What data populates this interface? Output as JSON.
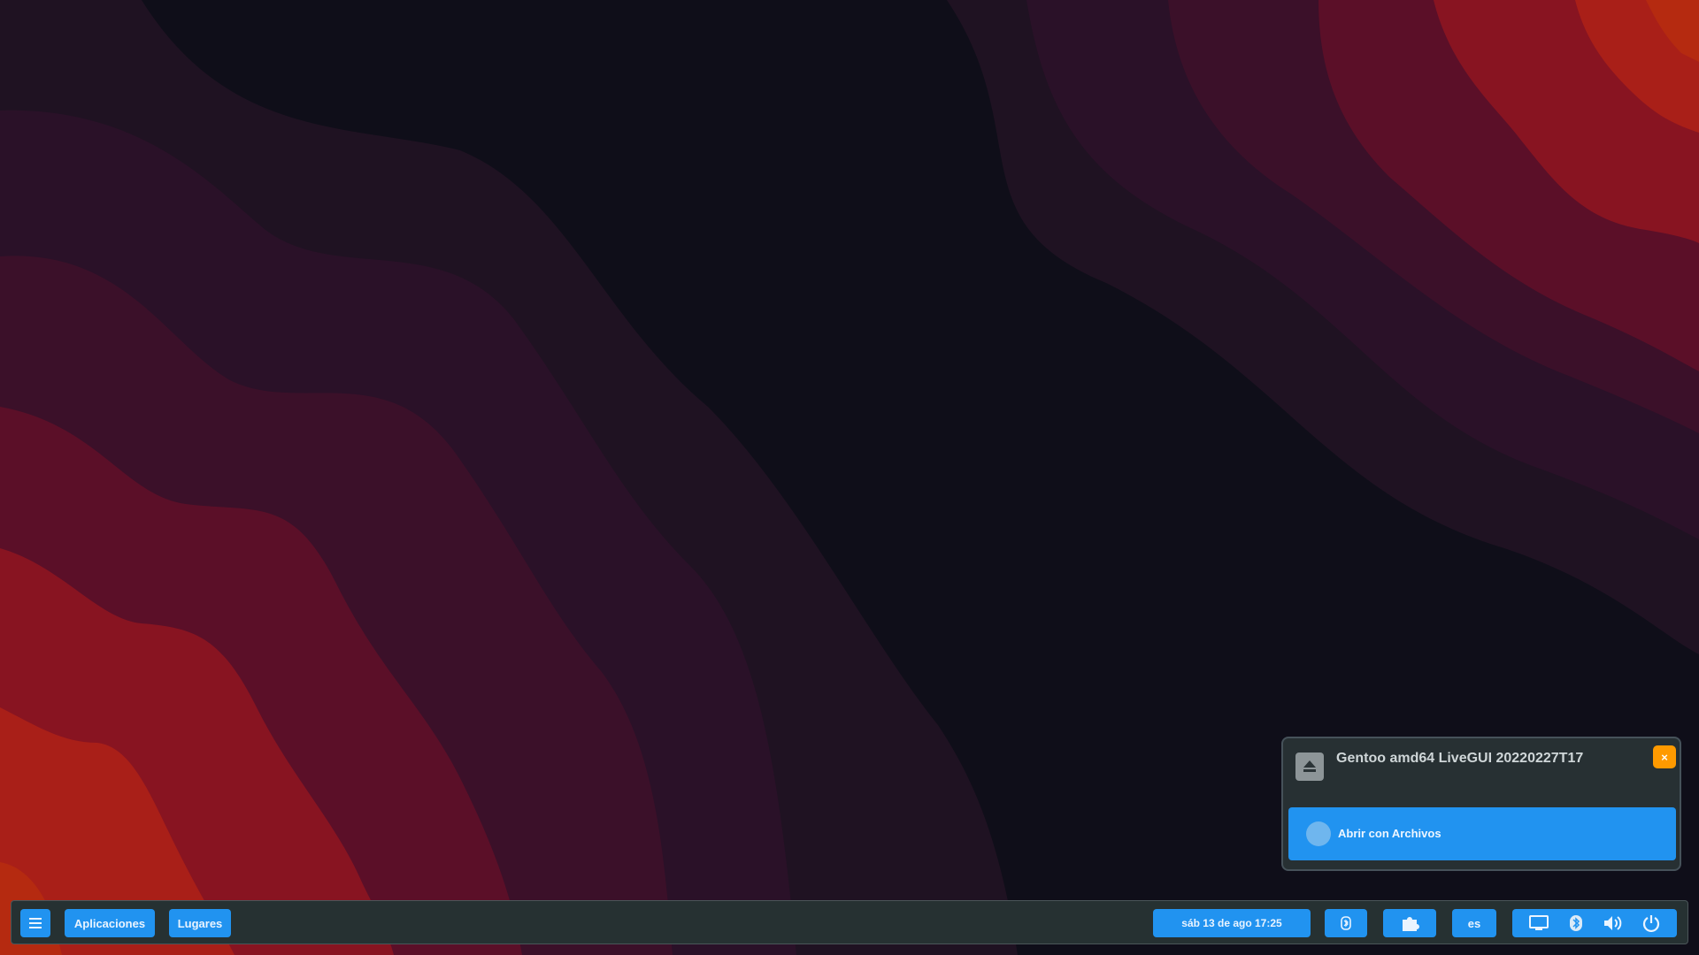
{
  "notification": {
    "icon": "eject-icon",
    "title": "Gentoo amd64 LiveGUI 20220227T17",
    "close_label": "×",
    "action_icon": "files-icon",
    "action_label": "Abrir con Archivos"
  },
  "panel": {
    "menu_icon": "hamburger-menu-icon",
    "applications_label": "Aplicaciones",
    "places_label": "Lugares",
    "datetime": "sáb 13 de ago  17:25",
    "bluetooth_indicator_icon": "bluetooth-icon",
    "extensions_icon": "puzzle-icon",
    "keyboard_layout": "es",
    "tray_icons": [
      "screen-icon",
      "bluetooth-icon",
      "volume-icon",
      "power-icon"
    ]
  },
  "colors": {
    "accent": "#2193f0",
    "panel_bg": "#263132",
    "close_button": "#ff9a00"
  }
}
